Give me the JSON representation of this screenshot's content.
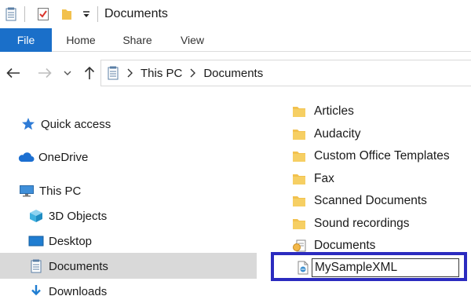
{
  "titlebar": {
    "title": "Documents"
  },
  "ribbon": {
    "tabs": [
      "File",
      "Home",
      "Share",
      "View"
    ]
  },
  "address": {
    "crumbs": [
      "This PC",
      "Documents"
    ]
  },
  "navpane": {
    "items": [
      {
        "label": "Quick access",
        "icon": "star-icon"
      },
      {
        "label": "OneDrive",
        "icon": "cloud-icon"
      },
      {
        "label": "This PC",
        "icon": "computer-icon"
      },
      {
        "label": "3D Objects",
        "icon": "cube-icon"
      },
      {
        "label": "Desktop",
        "icon": "desktop-icon"
      },
      {
        "label": "Documents",
        "icon": "document-icon"
      },
      {
        "label": "Downloads",
        "icon": "download-icon"
      }
    ],
    "selected": "Documents"
  },
  "content": {
    "items": [
      {
        "label": "Articles",
        "icon": "folder-icon"
      },
      {
        "label": "Audacity",
        "icon": "folder-icon"
      },
      {
        "label": "Custom Office Templates",
        "icon": "folder-icon"
      },
      {
        "label": "Fax",
        "icon": "folder-icon"
      },
      {
        "label": "Scanned Documents",
        "icon": "folder-icon"
      },
      {
        "label": "Sound recordings",
        "icon": "folder-icon"
      },
      {
        "label": "Documents",
        "icon": "library-icon"
      }
    ],
    "renaming": {
      "value": "MySampleXML",
      "icon": "xml-file-icon"
    }
  },
  "colors": {
    "accent": "#1a6fc9",
    "highlight_border": "#2b2bbf",
    "selection": "#d9d9d9",
    "folder": "#f2c14e"
  }
}
